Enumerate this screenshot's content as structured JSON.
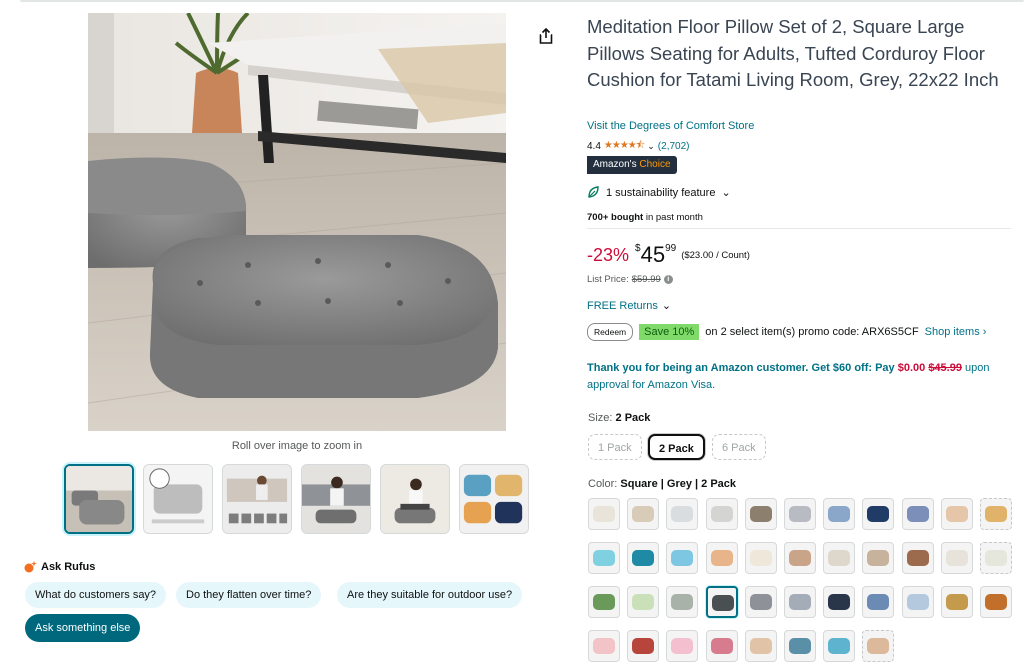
{
  "gallery": {
    "zoom_hint": "Roll over image to zoom in"
  },
  "rufus": {
    "title": "Ask Rufus",
    "questions": [
      "What do customers say?",
      "Do they flatten over time?",
      "Are they suitable for outdoor use?"
    ],
    "ask_button": "Ask something else"
  },
  "product": {
    "title": "Meditation Floor Pillow Set of 2, Square Large Pillows Seating for Adults, Tufted Corduroy Floor Cushion for Tatami Living Room, Grey, 22x22 Inch",
    "store_link": "Visit the Degrees of Comfort Store",
    "rating": "4.4",
    "rating_count": "(2,702)",
    "badge_prefix": "Amazon's",
    "badge_choice": "Choice",
    "sustainability": "1 sustainability feature",
    "bought_bold": "700+ bought",
    "bought_rest": "in past month"
  },
  "price": {
    "discount": "-23%",
    "currency": "$",
    "whole": "45",
    "fraction": "99",
    "per_unit": "($23.00 / Count)",
    "list_label": "List Price:",
    "list_value": "$59.99",
    "returns": "FREE Returns"
  },
  "promo": {
    "redeem": "Redeem",
    "save": "Save 10%",
    "text": "on 2 select item(s) promo code: ARX6S5CF",
    "shop_items": "Shop items ›"
  },
  "visa": {
    "part1": "Thank you for being an Amazon customer. Get $60 off: Pay ",
    "price_now": "$0.00",
    "price_old": "$45.99",
    "part2": " upon approval for Amazon Visa."
  },
  "size": {
    "label": "Size:",
    "selected": "2 Pack",
    "options": [
      "1 Pack",
      "2 Pack",
      "6 Pack"
    ]
  },
  "color": {
    "label": "Color:",
    "selected": "Square | Grey | 2 Pack",
    "swatch_colors": [
      [
        "#e9e4da",
        "#d8cbb8",
        "#d9dde0",
        "#d4d4d2",
        "#8d7f6e",
        "#b8bcc2",
        "#8aa6c9",
        "#1f3b66",
        "#7c8fb8",
        "#e6c6a8",
        "#e1b36a"
      ],
      [
        "#7fd0e0",
        "#1f8aa6",
        "#7ec7e3",
        "#e8b48a",
        "#efe7da",
        "#caa488",
        "#ded8cc",
        "#c7b39c",
        "#9c6b4d",
        "#e7e3db",
        "#e5e6dc"
      ],
      [
        "#6a9a5a",
        "#c9e0b8",
        "#a9b2a8",
        "#4a4f52",
        "#8e9298",
        "#a4acb8",
        "#29364a",
        "#6b8bb5",
        "#b5c9de",
        "#c49a4c",
        "#c26f2b"
      ],
      [
        "#f2c4c8",
        "#b8453b",
        "#f4c0cf",
        "#d67c8e",
        "#e1c3a8",
        "#5a8fa8",
        "#5eb3cf",
        "#dcb99a"
      ]
    ]
  }
}
